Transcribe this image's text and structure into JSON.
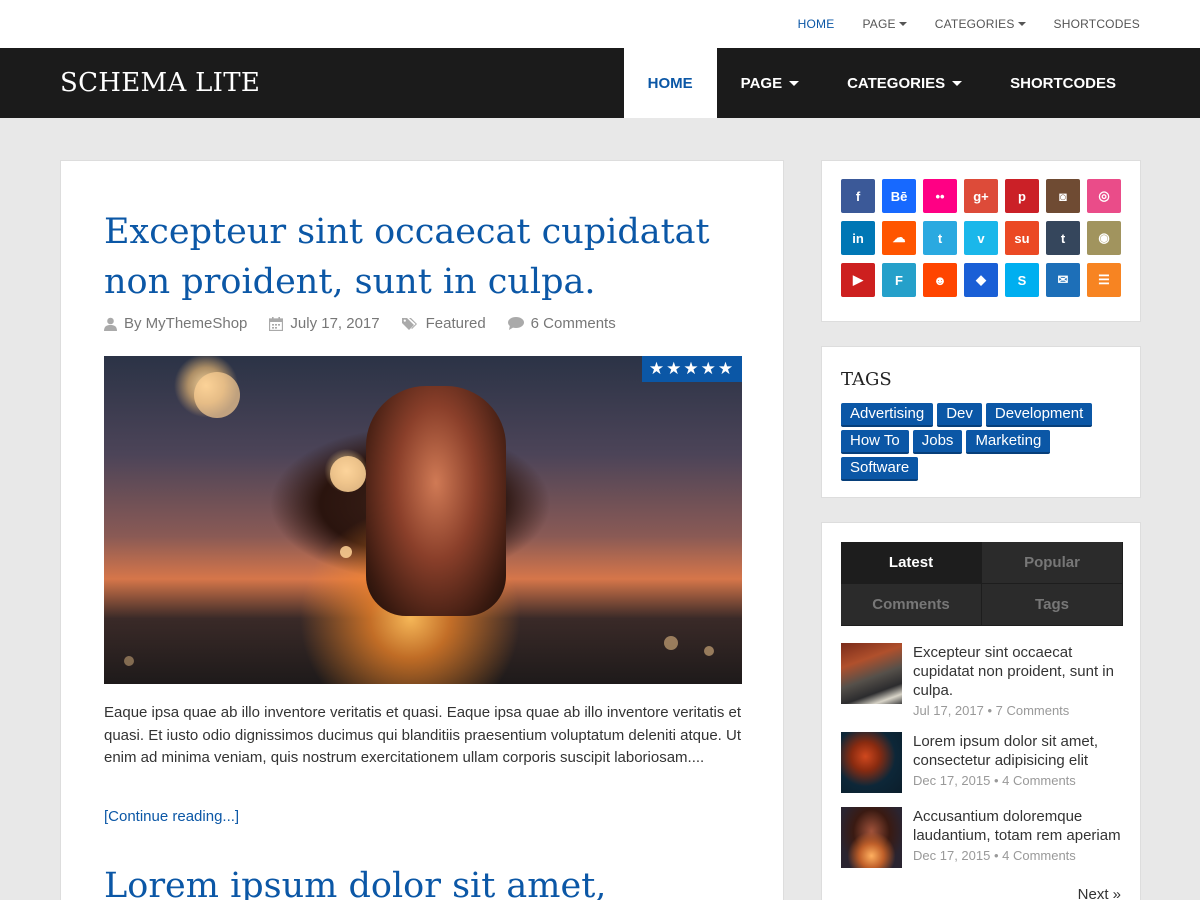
{
  "topnav": {
    "items": [
      {
        "label": "HOME",
        "active": true
      },
      {
        "label": "PAGE",
        "dropdown": true
      },
      {
        "label": "CATEGORIES",
        "dropdown": true
      },
      {
        "label": "SHORTCODES"
      }
    ]
  },
  "header": {
    "logo": "SCHEMA LITE",
    "nav": [
      {
        "label": "HOME",
        "active": true
      },
      {
        "label": "PAGE",
        "dropdown": true
      },
      {
        "label": "CATEGORIES",
        "dropdown": true
      },
      {
        "label": "SHORTCODES"
      }
    ]
  },
  "post": {
    "title": "Excepteur sint occaecat cupidatat non proident, sunt in culpa.",
    "author": "By MyThemeShop",
    "date": "July 17, 2017",
    "category": "Featured",
    "comments": "6 Comments",
    "rating": "★★★★★",
    "excerpt": "Eaque ipsa quae ab illo inventore veritatis et quasi. Eaque ipsa quae ab illo inventore veritatis et quasi. Et iusto odio dignissimos ducimus qui blanditiis praesentium voluptatum deleniti atque. Ut enim ad minima veniam, quis nostrum exercitationem ullam corporis suscipit laboriosam....",
    "read_more": "[Continue reading...]"
  },
  "post2": {
    "title": "Lorem ipsum dolor sit amet,"
  },
  "social": {
    "icons": [
      {
        "name": "facebook-icon",
        "glyph": "f",
        "color": "#3b5998"
      },
      {
        "name": "behance-icon",
        "glyph": "Bē",
        "color": "#1769ff"
      },
      {
        "name": "flickr-icon",
        "glyph": "••",
        "color": "#ff0084"
      },
      {
        "name": "google-plus-icon",
        "glyph": "g+",
        "color": "#dd4b39"
      },
      {
        "name": "pinterest-icon",
        "glyph": "p",
        "color": "#cb2027"
      },
      {
        "name": "instagram-icon",
        "glyph": "◙",
        "color": "#6f4b33"
      },
      {
        "name": "dribbble-icon",
        "glyph": "◎",
        "color": "#ea4c89"
      },
      {
        "name": "linkedin-icon",
        "glyph": "in",
        "color": "#0077b5"
      },
      {
        "name": "soundcloud-icon",
        "glyph": "☁",
        "color": "#ff5500"
      },
      {
        "name": "twitter-icon",
        "glyph": "t",
        "color": "#2aa9e0"
      },
      {
        "name": "vimeo-icon",
        "glyph": "v",
        "color": "#1ab7ea"
      },
      {
        "name": "stumbleupon-icon",
        "glyph": "su",
        "color": "#eb4924"
      },
      {
        "name": "tumblr-icon",
        "glyph": "t",
        "color": "#35465c"
      },
      {
        "name": "github-icon",
        "glyph": "◉",
        "color": "#a1945e"
      },
      {
        "name": "youtube-icon",
        "glyph": "▶",
        "color": "#cd201f"
      },
      {
        "name": "foursquare-icon",
        "glyph": "F",
        "color": "#25a0ca"
      },
      {
        "name": "reddit-icon",
        "glyph": "☻",
        "color": "#ff4500"
      },
      {
        "name": "dropbox-icon",
        "glyph": "◆",
        "color": "#1a5fd6"
      },
      {
        "name": "skype-icon",
        "glyph": "S",
        "color": "#00aff0"
      },
      {
        "name": "email-icon",
        "glyph": "✉",
        "color": "#1d6fb8"
      },
      {
        "name": "rss-icon",
        "glyph": "☰",
        "color": "#f78422"
      }
    ]
  },
  "tags_widget": {
    "title": "TAGS",
    "tags": [
      "Advertising",
      "Dev",
      "Development",
      "How To",
      "Jobs",
      "Marketing",
      "Software"
    ]
  },
  "tabs_widget": {
    "tabs": [
      "Latest",
      "Popular",
      "Comments",
      "Tags"
    ],
    "posts": [
      {
        "title": "Excepteur sint occaecat cupidatat non proident, sunt in culpa.",
        "meta": "Jul 17, 2017 • 7 Comments"
      },
      {
        "title": "Lorem ipsum dolor sit amet, consectetur adipisicing elit",
        "meta": "Dec 17, 2015 • 4 Comments"
      },
      {
        "title": "Accusantium doloremque laudantium, totam rem aperiam",
        "meta": "Dec 17, 2015 • 4 Comments"
      }
    ],
    "next": "Next »"
  }
}
